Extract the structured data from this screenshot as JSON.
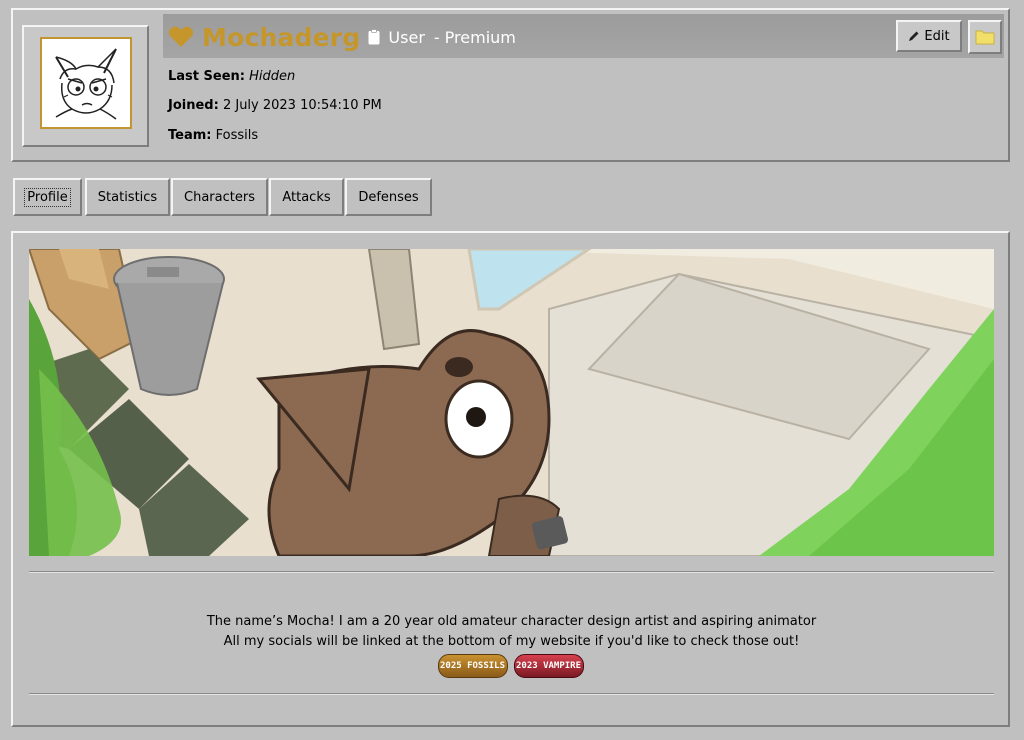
{
  "profile": {
    "username": "Mochaderg",
    "role": "User",
    "separator": "-",
    "tier": "Premium",
    "last_seen_label": "Last Seen:",
    "last_seen_value": "Hidden",
    "joined_label": "Joined:",
    "joined_value": "2 July 2023 10:54:10 PM",
    "team_label": "Team:",
    "team_value": "Fossils",
    "username_color": "#c4962c"
  },
  "toolbar": {
    "edit_label": "Edit"
  },
  "tabs": [
    {
      "label": "Profile",
      "active": true
    },
    {
      "label": "Statistics",
      "active": false
    },
    {
      "label": "Characters",
      "active": false
    },
    {
      "label": "Attacks",
      "active": false
    },
    {
      "label": "Defenses",
      "active": false
    }
  ],
  "bio": {
    "line1": "The name’s Mocha! I am a 20 year old amateur character design artist and aspiring animator",
    "line2": "All my socials will be linked at the bottom of my website if you'd like to check those out!"
  },
  "badges": [
    {
      "text": "2025 FOSSILS",
      "color": "#c28a2a"
    },
    {
      "text": "2023 VAMPIRE",
      "color": "#b02a3a"
    }
  ],
  "icons": [
    "heart-icon",
    "clipboard-icon",
    "pencil-icon",
    "folder-icon"
  ]
}
